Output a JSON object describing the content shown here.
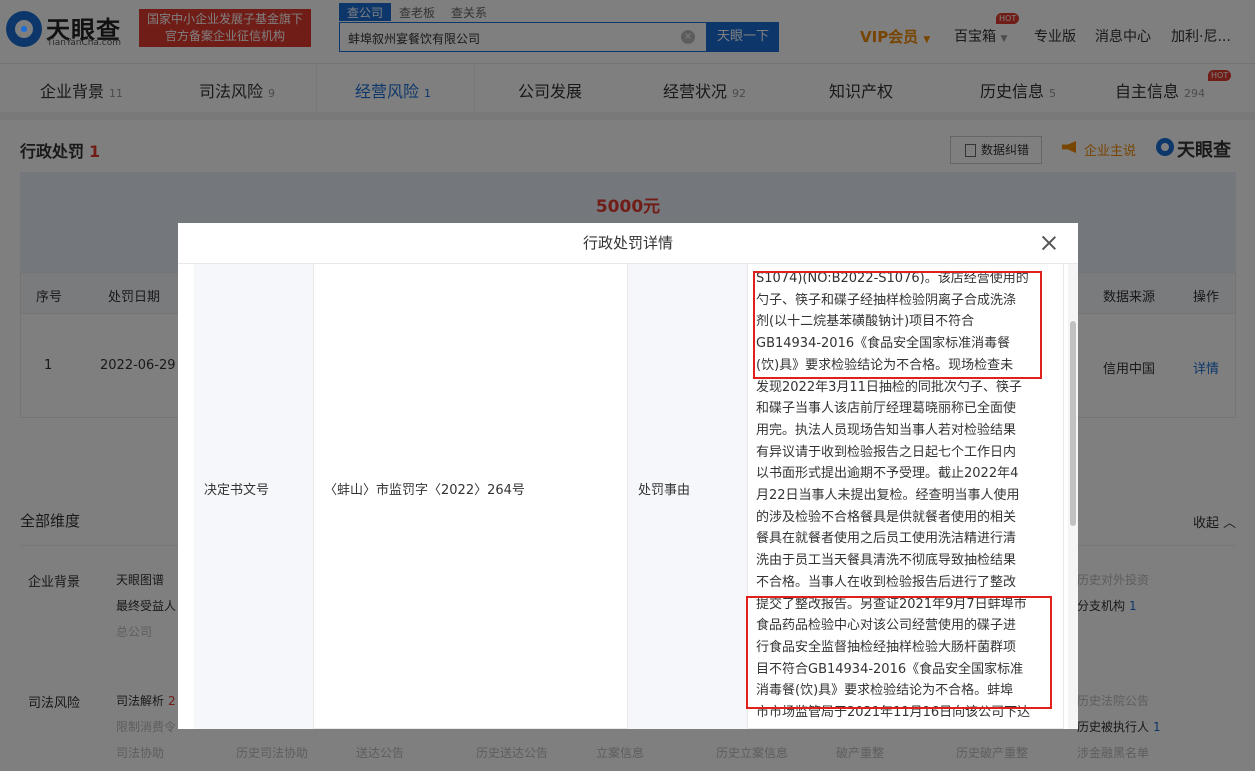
{
  "header": {
    "logo_cn": "天眼查",
    "logo_en": "TianYanCha.com",
    "gov_badge_line1": "国家中小企业发展子基金旗下",
    "gov_badge_line2": "官方备案企业征信机构",
    "search_tabs": [
      "查公司",
      "查老板",
      "查关系"
    ],
    "search_value": "蚌埠叙州宴餐饮有限公司",
    "search_button": "天眼一下",
    "vip": "VIP会员",
    "baibaoxiang": "百宝箱",
    "hot": "HOT",
    "pro": "专业版",
    "messages": "消息中心",
    "user": "加利·尼..."
  },
  "tabs": [
    {
      "label": "企业背景",
      "count": "11"
    },
    {
      "label": "司法风险",
      "count": "9"
    },
    {
      "label": "经营风险",
      "count": "1"
    },
    {
      "label": "公司发展",
      "count": ""
    },
    {
      "label": "经营状况",
      "count": "92"
    },
    {
      "label": "知识产权",
      "count": ""
    },
    {
      "label": "历史信息",
      "count": "5"
    },
    {
      "label": "自主信息",
      "count": "294"
    }
  ],
  "section": {
    "title": "行政处罚",
    "count": "1",
    "data_error_button": "数据纠错",
    "ad_label": "企业主说",
    "watermark": "天眼查",
    "amount": "5000元"
  },
  "table": {
    "headers": {
      "seq": "序号",
      "date": "处罚日期",
      "source": "数据来源",
      "action": "操作"
    },
    "row": {
      "seq": "1",
      "date": "2022-06-29",
      "source": "信用中国",
      "action": "详情"
    }
  },
  "dimensions": {
    "title": "全部维度",
    "collapse": "收起",
    "categories": {
      "bg": "企业背景",
      "judicial": "司法风险"
    },
    "items": {
      "tianyantu": "天眼图谱",
      "beneficiary": "最终受益人",
      "headquarters": "总公司",
      "hist_investment": "历史对外投资",
      "branches": "分支机构",
      "branches_count": "1",
      "judicial_analysis": "司法解析",
      "judicial_analysis_count": "2",
      "consumption_limit": "限制消费令",
      "hist_court_notice": "历史法院公告",
      "hist_executed": "历史被执行人",
      "hist_executed_count": "1",
      "judicial_assist": "司法协助",
      "hist_judicial_assist": "历史司法协助",
      "delivery_notice": "送达公告",
      "hist_delivery_notice": "历史送达公告",
      "filing_info": "立案信息",
      "hist_filing": "历史立案信息",
      "bankruptcy": "破产重整",
      "hist_bankruptcy": "历史破产重整",
      "gambling_list": "涉金融黑名单"
    }
  },
  "modal": {
    "title": "行政处罚详情",
    "label_doc": "决定书文号",
    "doc_number": "〈蚌山〉市监罚字〈2022〉264号",
    "label_reason": "处罚事由",
    "reason_lines": [
      "S1074)(NO:B2022-S1076)。该店经营使用的",
      "勺子、筷子和碟子经抽样检验阴离子合成洗涤",
      "剂(以十二烷基苯磺酸钠计)项目不符合",
      "GB14934-2016《食品安全国家标准消毒餐",
      "(饮)具》要求检验结论为不合格。现场检查未",
      "发现2022年3月11日抽检的同批次勺子、筷子",
      "和碟子当事人该店前厅经理葛晓丽称已全面使",
      "用完。执法人员现场告知当事人若对检验结果",
      "有异议请于收到检验报告之日起七个工作日内",
      "以书面形式提出逾期不予受理。截止2022年4",
      "月22日当事人未提出复检。经查明当事人使用",
      "的涉及检验不合格餐具是供就餐者使用的相关",
      "餐具在就餐者使用之后员工使用洗洁精进行清",
      "洗由于员工当天餐具清洗不彻底导致抽检结果",
      "不合格。当事人在收到检验报告后进行了整改",
      "提交了整改报告。另查证2021年9月7日蚌埠市",
      "食品药品检验中心对该公司经营使用的碟子进",
      "行食品安全监督抽检经抽样检验大肠杆菌群项",
      "目不符合GB14934-2016《食品安全国家标准",
      "消毒餐(饮)具》要求检验结论为不合格。蚌埠",
      "市市场监管局于2021年11月16日向该公司下达"
    ]
  },
  "colors": {
    "brand_blue": "#1a6fd6",
    "highlight_red": "#e0201a",
    "vip_orange": "#f08a00"
  }
}
